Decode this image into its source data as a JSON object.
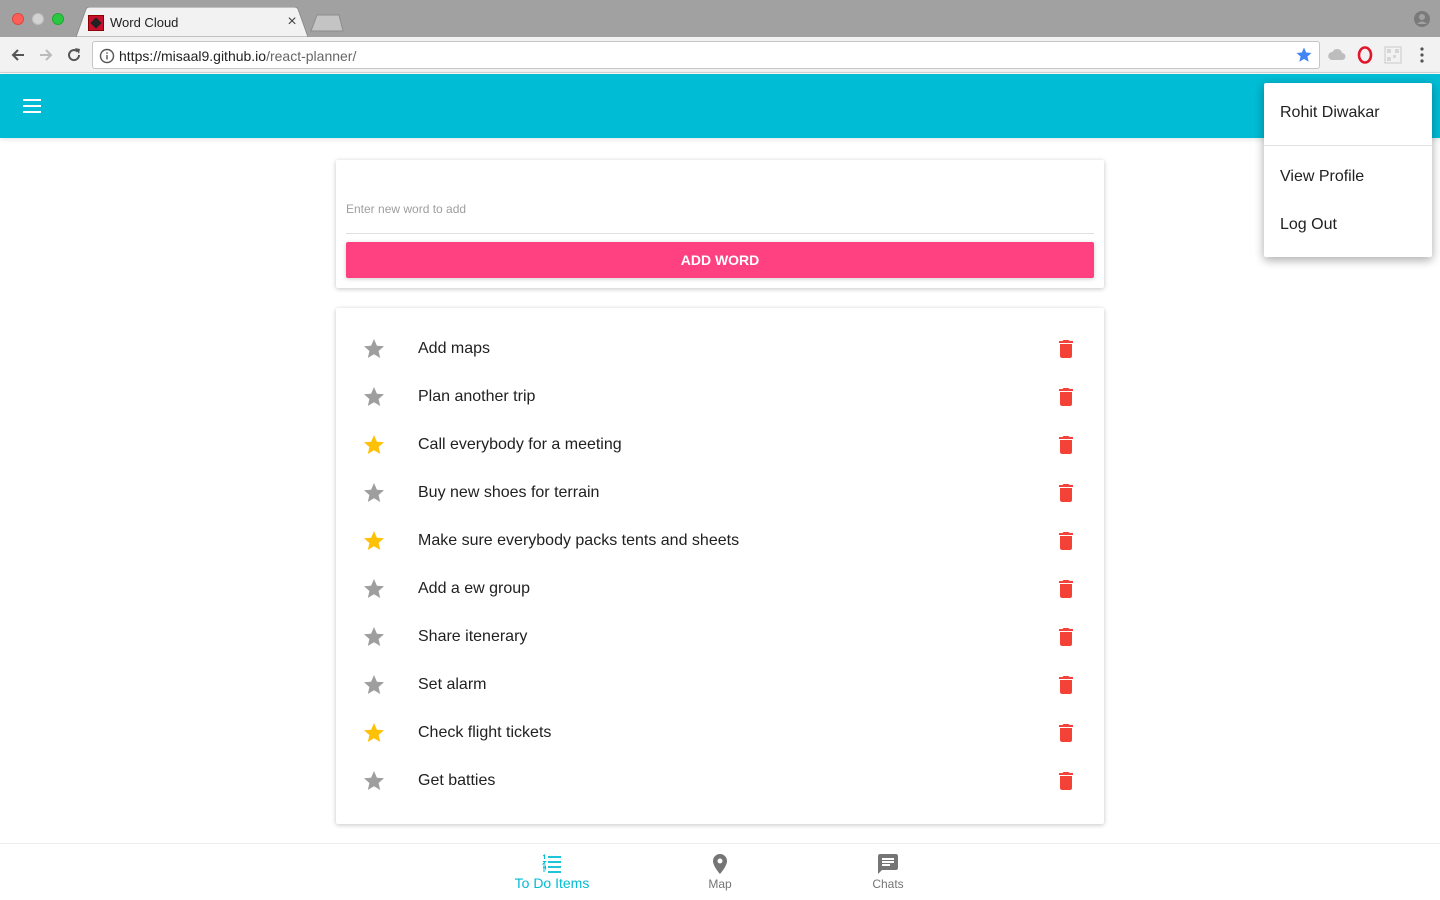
{
  "browser": {
    "tab_title": "Word Cloud",
    "tab_close": "×",
    "url_host": "https://misaal9.github.io",
    "url_path": "/react-planner/"
  },
  "colors": {
    "primary": "#00bcd4",
    "accent": "#ff4081",
    "star_active": "#ffc107",
    "star_inactive": "#9e9e9e",
    "delete": "#f44336"
  },
  "form": {
    "placeholder": "Enter new word to add",
    "value": "",
    "add_button_label": "ADD WORD"
  },
  "todos": [
    {
      "text": "Add maps",
      "starred": false
    },
    {
      "text": "Plan another trip",
      "starred": false
    },
    {
      "text": "Call everybody for a meeting",
      "starred": true
    },
    {
      "text": "Buy new shoes for terrain",
      "starred": false
    },
    {
      "text": "Make sure everybody packs tents and sheets",
      "starred": true
    },
    {
      "text": "Add a ew group",
      "starred": false
    },
    {
      "text": "Share itenerary",
      "starred": false
    },
    {
      "text": "Set alarm",
      "starred": false
    },
    {
      "text": "Check flight tickets",
      "starred": true
    },
    {
      "text": "Get batties",
      "starred": false
    }
  ],
  "user_menu": {
    "user_name": "Rohit Diwakar",
    "view_profile": "View Profile",
    "log_out": "Log Out"
  },
  "bottom_nav": {
    "todo_label": "To Do Items",
    "map_label": "Map",
    "chats_label": "Chats",
    "active": "todo"
  }
}
